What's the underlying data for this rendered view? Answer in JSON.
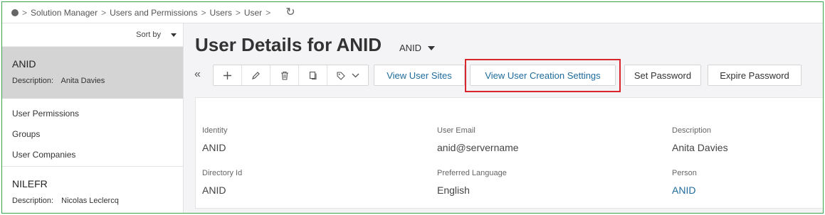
{
  "breadcrumb": {
    "items": [
      "Solution Manager",
      "Users and Permissions",
      "Users",
      "User"
    ]
  },
  "navigator": {
    "sort_label": "Sort by",
    "records": [
      {
        "title": "ANID",
        "desc_label": "Description:",
        "desc_value": "Anita Davies",
        "selected": true
      },
      {
        "title": "NILEFR",
        "desc_label": "Description:",
        "desc_value": "Nicolas Leclercq",
        "selected": false
      }
    ],
    "links": [
      "User Permissions",
      "Groups",
      "User Companies"
    ]
  },
  "page": {
    "title": "User Details for ANID",
    "key_selector": "ANID"
  },
  "toolbar": {
    "buttons": [
      "View User Sites",
      "View User Creation Settings",
      "Set Password",
      "Expire Password"
    ],
    "highlighted_button": "View User Creation Settings"
  },
  "fields": [
    {
      "label": "Identity",
      "value": "ANID"
    },
    {
      "label": "User Email",
      "value": "anid@servername"
    },
    {
      "label": "Description",
      "value": "Anita Davies"
    },
    {
      "label": "Directory Id",
      "value": "ANID"
    },
    {
      "label": "Preferred Language",
      "value": "English"
    },
    {
      "label": "Person",
      "value": "ANID",
      "is_link": true
    }
  ],
  "colors": {
    "frame_border": "#3aa54a",
    "link": "#1e6b9c",
    "highlight": "#d9262c",
    "selected_record": "#d4d4d4"
  }
}
